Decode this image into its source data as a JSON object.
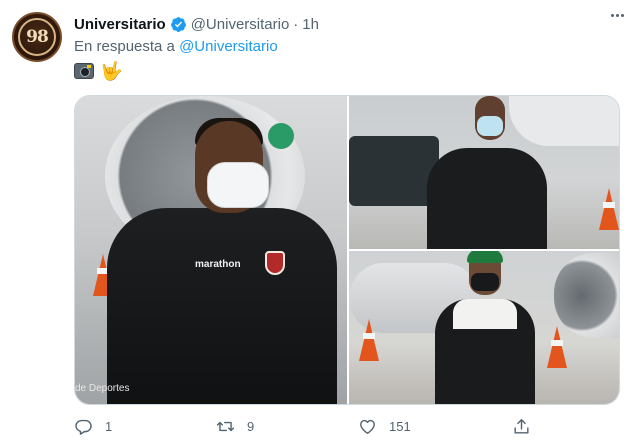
{
  "tweet": {
    "avatar_text": "98",
    "display_name": "Universitario",
    "handle": "@Universitario",
    "separator": "·",
    "time": "1h",
    "reply_prefix": "En respuesta a",
    "reply_handle": "@Universitario",
    "emojis": [
      "camera-with-flash-emoji",
      "sign-of-the-horns-emoji"
    ],
    "emoji_hand_glyph": "🤟",
    "photo_brand_text": "marathon",
    "photo_watermark": "de Deportes",
    "actions": {
      "replies": "1",
      "retweets": "9",
      "likes": "151"
    },
    "colors": {
      "link": "#1d9bf0",
      "verified": "#1d9bf0",
      "secondary_text": "#536471"
    }
  }
}
